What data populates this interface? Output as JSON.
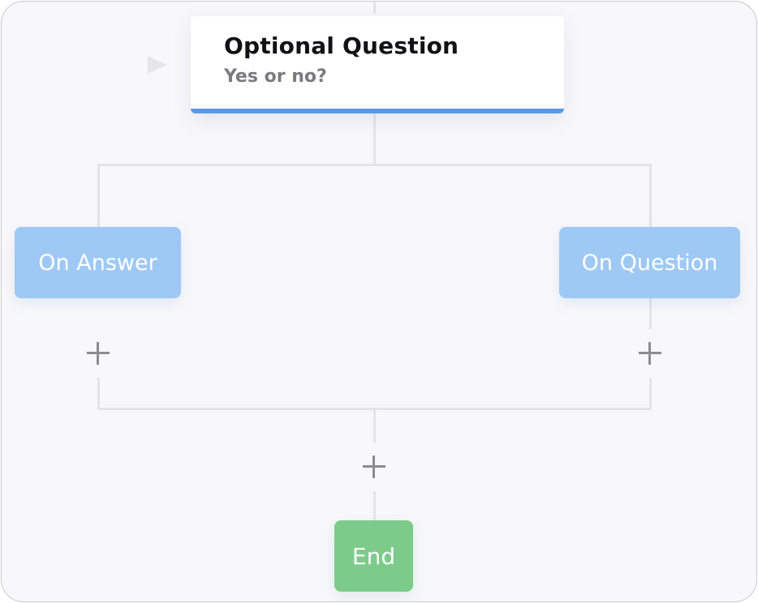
{
  "question_node": {
    "title": "Optional Question",
    "subtitle": "Yes or no?",
    "accent_color": "#5b9be6"
  },
  "branches": {
    "left_label": "On Answer",
    "right_label": "On Question",
    "color": "#9ec9f4"
  },
  "end_node": {
    "label": "End",
    "color": "#7ccb8a"
  },
  "icons": {
    "play": "play-icon",
    "add": "plus-icon"
  }
}
